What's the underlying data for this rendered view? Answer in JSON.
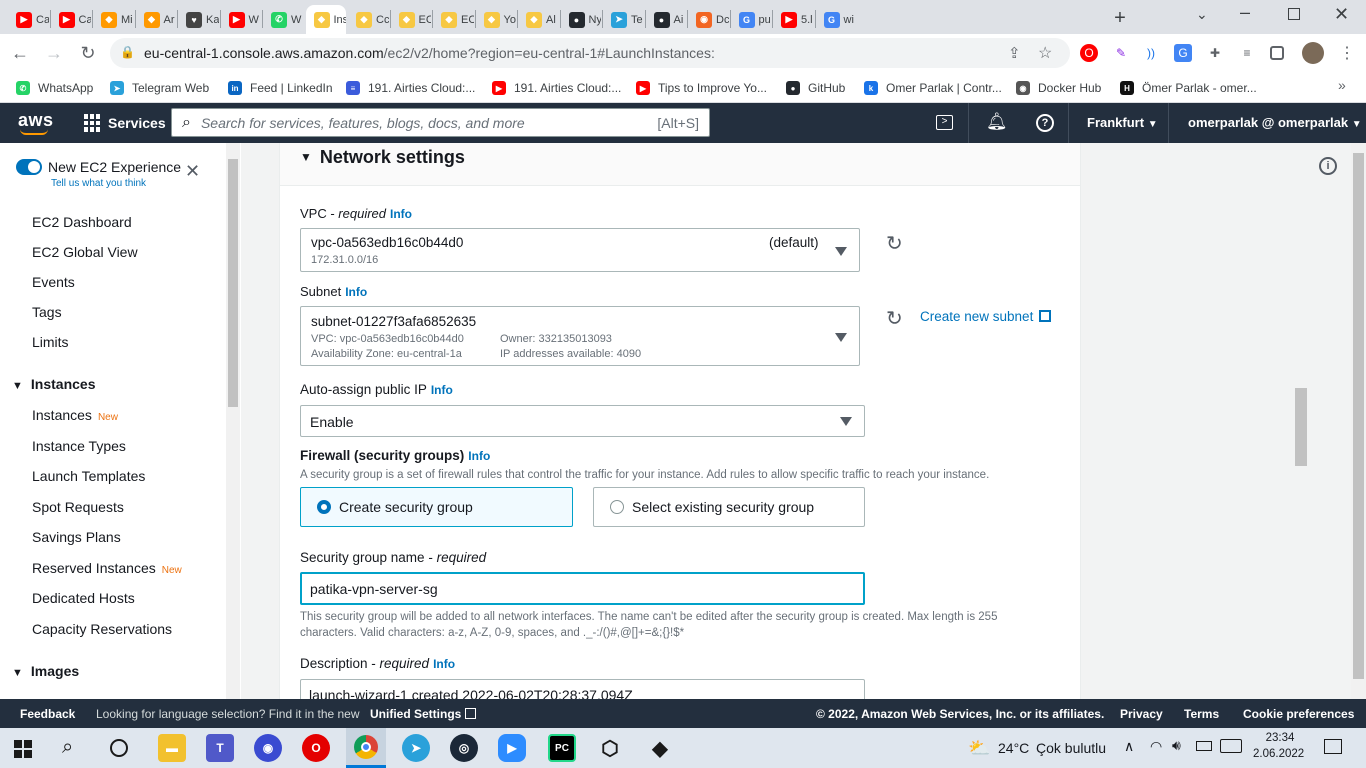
{
  "browser": {
    "tabs": [
      {
        "label": "Ca",
        "color": "#ff0000",
        "glyph": "▶"
      },
      {
        "label": "Ca",
        "color": "#ff0000",
        "glyph": "▶"
      },
      {
        "label": "Mi",
        "color": "#ff9900",
        "glyph": "◆"
      },
      {
        "label": "Ar",
        "color": "#ff9900",
        "glyph": "◆"
      },
      {
        "label": "Ka",
        "color": "#444444",
        "glyph": "♥"
      },
      {
        "label": "W",
        "color": "#ff0000",
        "glyph": "▶"
      },
      {
        "label": "W",
        "color": "#25d366",
        "glyph": "✆"
      },
      {
        "label": "Ins",
        "color": "#f7c843",
        "glyph": "◆"
      },
      {
        "label": "Cc",
        "color": "#f7c843",
        "glyph": "◆"
      },
      {
        "label": "EC",
        "color": "#f7c843",
        "glyph": "◆"
      },
      {
        "label": "EC",
        "color": "#f7c843",
        "glyph": "◆"
      },
      {
        "label": "Yo",
        "color": "#f7c843",
        "glyph": "◆"
      },
      {
        "label": "Al",
        "color": "#f7c843",
        "glyph": "◆"
      },
      {
        "label": "Ny",
        "color": "#24292f",
        "glyph": "●"
      },
      {
        "label": "Te",
        "color": "#2aa1da",
        "glyph": "➤"
      },
      {
        "label": "Ai",
        "color": "#24292f",
        "glyph": "●"
      },
      {
        "label": "Dc",
        "color": "#f26522",
        "glyph": "◉"
      },
      {
        "label": "pu",
        "color": "#4285f4",
        "glyph": "G"
      },
      {
        "label": "5.l",
        "color": "#ff0000",
        "glyph": "▶"
      },
      {
        "label": "wi",
        "color": "#4285f4",
        "glyph": "G"
      }
    ],
    "new_tab": "+",
    "url_host": "eu-central-1.console.aws.amazon.com",
    "url_path": "/ec2/v2/home?region=eu-central-1#LaunchInstances:",
    "bookmarks": [
      {
        "label": "WhatsApp",
        "color": "#25d366",
        "glyph": "✆"
      },
      {
        "label": "Telegram Web",
        "color": "#2aa1da",
        "glyph": "➤"
      },
      {
        "label": "Feed | LinkedIn",
        "color": "#0a66c2",
        "glyph": "in"
      },
      {
        "label": "191. Airties Cloud:...",
        "color": "#3b5bdb",
        "glyph": "≡"
      },
      {
        "label": "191. Airties Cloud:...",
        "color": "#ff0000",
        "glyph": "▶"
      },
      {
        "label": "Tips to Improve Yo...",
        "color": "#ff0000",
        "glyph": "▶"
      },
      {
        "label": "GitHub",
        "color": "#24292f",
        "glyph": "●"
      },
      {
        "label": "Omer Parlak | Contr...",
        "color": "#1a73e8",
        "glyph": "k"
      },
      {
        "label": "Docker Hub",
        "color": "#555555",
        "glyph": "◉"
      },
      {
        "label": "Ömer Parlak - omer...",
        "color": "#111111",
        "glyph": "H"
      }
    ]
  },
  "aws": {
    "logo": "aws",
    "services": "Services",
    "search_placeholder": "Search for services, features, blogs, docs, and more",
    "search_shortcut": "[Alt+S]",
    "region": "Frankfurt",
    "account": "omerparlak @ omerparlak"
  },
  "sidebar": {
    "toggle_label": "New EC2 Experience",
    "toggle_sub": "Tell us what you think",
    "items": [
      {
        "label": "EC2 Dashboard",
        "new": ""
      },
      {
        "label": "EC2 Global View",
        "new": ""
      },
      {
        "label": "Events",
        "new": ""
      },
      {
        "label": "Tags",
        "new": ""
      },
      {
        "label": "Limits",
        "new": ""
      }
    ],
    "group_instances": "Instances",
    "instances_items": [
      {
        "label": "Instances",
        "new": "New"
      },
      {
        "label": "Instance Types",
        "new": ""
      },
      {
        "label": "Launch Templates",
        "new": ""
      },
      {
        "label": "Spot Requests",
        "new": ""
      },
      {
        "label": "Savings Plans",
        "new": ""
      },
      {
        "label": "Reserved Instances",
        "new": "New"
      },
      {
        "label": "Dedicated Hosts",
        "new": ""
      },
      {
        "label": "Capacity Reservations",
        "new": ""
      }
    ],
    "group_images": "Images"
  },
  "network": {
    "section_title": "Network settings",
    "info": "Info",
    "vpc_label": "VPC",
    "required": "required",
    "vpc_value": "vpc-0a563edb16c0b44d0",
    "vpc_default": "(default)",
    "vpc_cidr": "172.31.0.0/16",
    "subnet_label": "Subnet",
    "subnet_value": "subnet-01227f3afa6852635",
    "subnet_vpc": "VPC: vpc-0a563edb16c0b44d0",
    "subnet_owner": "Owner: 332135013093",
    "subnet_az": "Availability Zone: eu-central-1a",
    "subnet_ips": "IP addresses available: 4090",
    "create_subnet": "Create new subnet",
    "public_ip_label": "Auto-assign public IP",
    "public_ip_value": "Enable",
    "firewall_label": "Firewall (security groups)",
    "firewall_desc": "A security group is a set of firewall rules that control the traffic for your instance. Add rules to allow specific traffic to reach your instance.",
    "create_sg": "Create security group",
    "select_sg": "Select existing security group",
    "sg_name_label": "Security group name",
    "sg_name_value": "patika-vpn-server-sg",
    "sg_help_1": "This security group will be added to all network interfaces. The name can't be edited after the security group is created. Max length is 255",
    "sg_help_2": "characters. Valid characters: a-z, A-Z, 0-9, spaces, and ._-:/()#,@[]+=&;{}!$*",
    "description_label": "Description",
    "description_value": "launch-wizard-1 created 2022-06-02T20:28:37.094Z"
  },
  "footer": {
    "feedback": "Feedback",
    "lang_text": "Looking for language selection? Find it in the new",
    "unified": "Unified Settings",
    "copyright": "© 2022, Amazon Web Services, Inc. or its affiliates.",
    "privacy": "Privacy",
    "terms": "Terms",
    "cookies": "Cookie preferences"
  },
  "taskbar": {
    "weather_temp": "24°C",
    "weather_text": "Çok bulutlu",
    "time": "23:34",
    "date": "2.06.2022"
  }
}
